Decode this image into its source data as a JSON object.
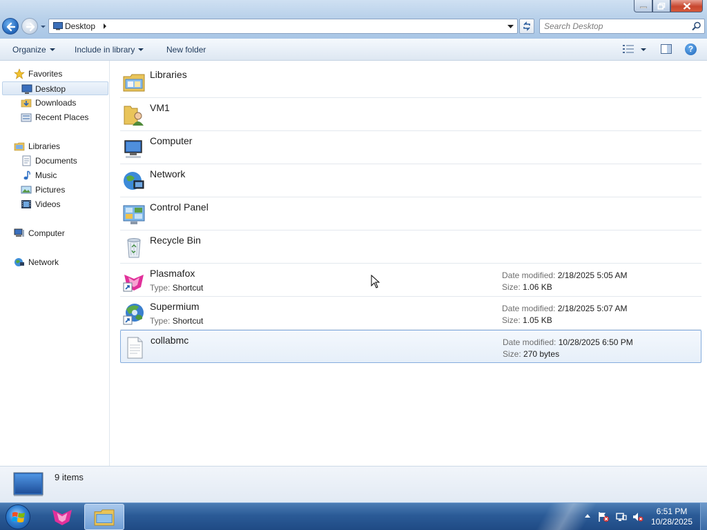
{
  "window": {
    "address": {
      "crumb": "Desktop"
    },
    "search": {
      "placeholder": "Search Desktop"
    }
  },
  "toolbar": {
    "organize": "Organize",
    "include_in_library": "Include in library",
    "new_folder": "New folder",
    "help": "?"
  },
  "nav": {
    "favorites": "Favorites",
    "desktop": "Desktop",
    "downloads": "Downloads",
    "recent_places": "Recent Places",
    "libraries": "Libraries",
    "documents": "Documents",
    "music": "Music",
    "pictures": "Pictures",
    "videos": "Videos",
    "computer": "Computer",
    "network": "Network"
  },
  "items": [
    {
      "name": "Libraries",
      "icon": "libraries-icon"
    },
    {
      "name": "VM1",
      "icon": "user-folder-icon"
    },
    {
      "name": "Computer",
      "icon": "computer-icon"
    },
    {
      "name": "Network",
      "icon": "network-icon"
    },
    {
      "name": "Control Panel",
      "icon": "control-panel-icon"
    },
    {
      "name": "Recycle Bin",
      "icon": "recycle-bin-icon"
    },
    {
      "name": "Plasmafox",
      "icon": "plasmafox-shortcut-icon",
      "type_label": "Type:",
      "type": "Shortcut",
      "date_label": "Date modified:",
      "date": "2/18/2025 5:05 AM",
      "size_label": "Size:",
      "size": "1.06 KB"
    },
    {
      "name": "Supermium",
      "icon": "supermium-shortcut-icon",
      "type_label": "Type:",
      "type": "Shortcut",
      "date_label": "Date modified:",
      "date": "2/18/2025 5:07 AM",
      "size_label": "Size:",
      "size": "1.05 KB"
    },
    {
      "name": "collabmc",
      "icon": "text-file-icon",
      "date_label": "Date modified:",
      "date": "10/28/2025 6:50 PM",
      "size_label": "Size:",
      "size": "270 bytes"
    }
  ],
  "details": {
    "count": "9 items"
  },
  "taskbar": {
    "time": "6:51 PM",
    "date": "10/28/2025"
  }
}
